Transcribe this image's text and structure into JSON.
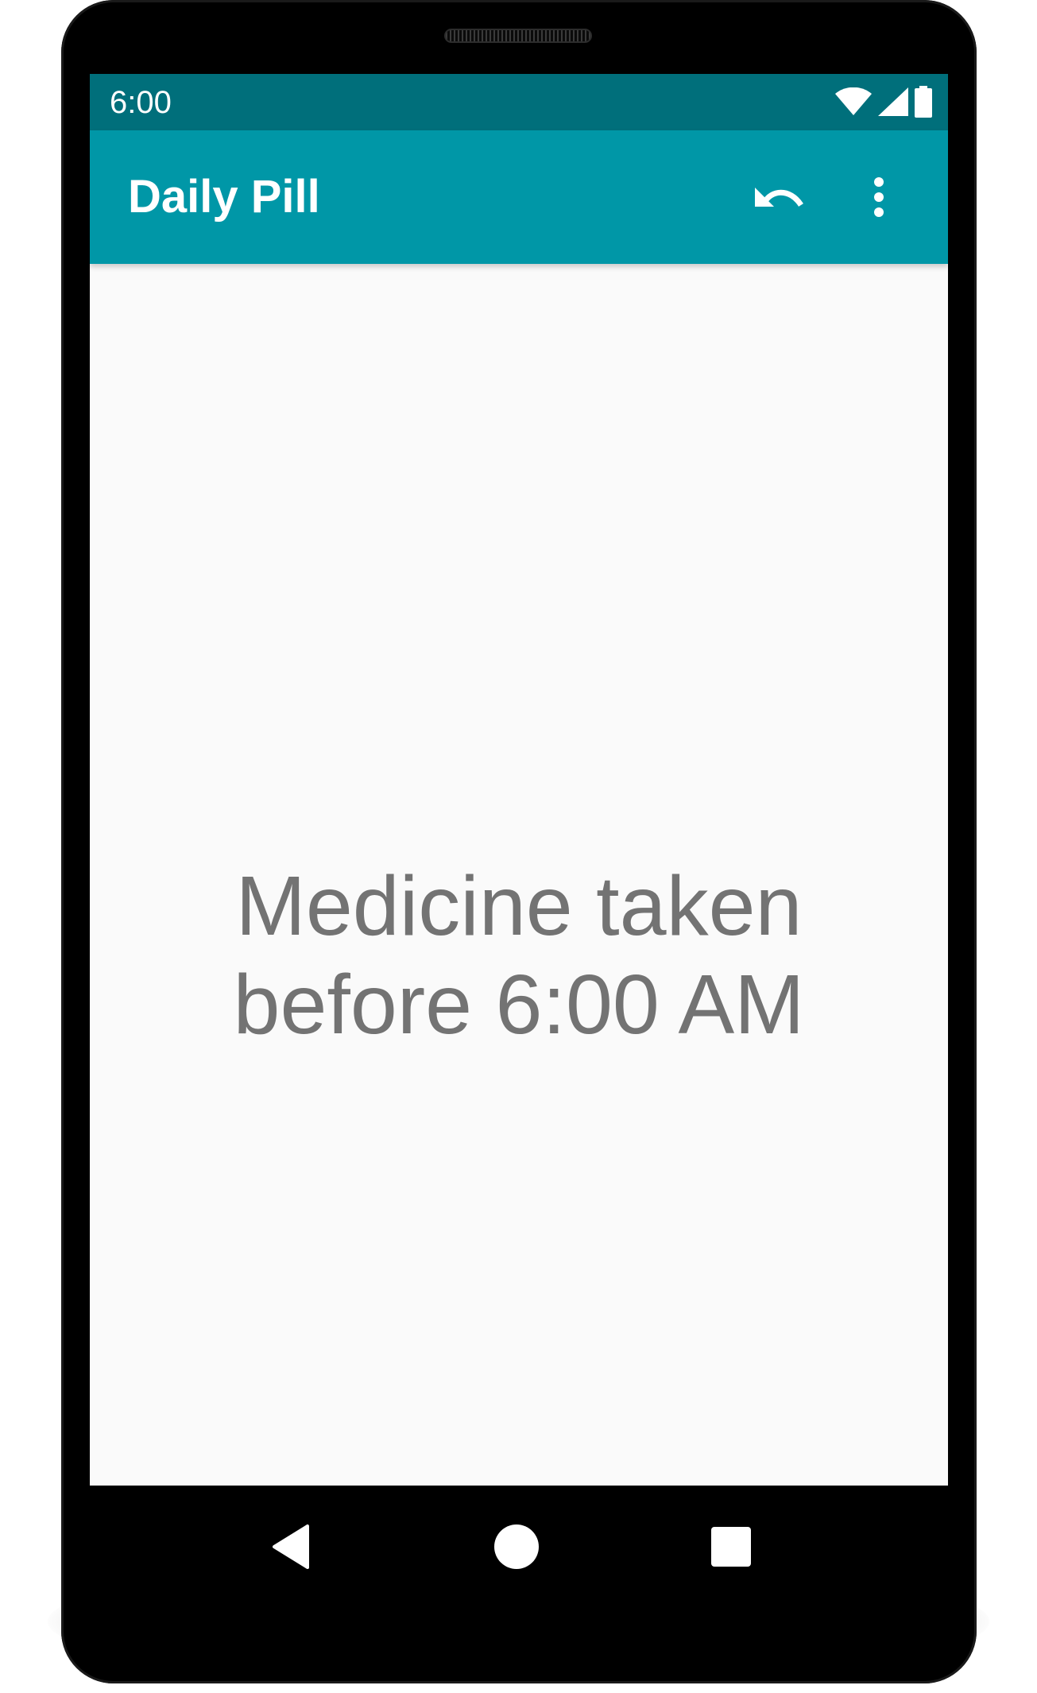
{
  "status_bar": {
    "time": "6:00",
    "icons": [
      "wifi-icon",
      "cell-signal-icon",
      "battery-icon"
    ]
  },
  "app_bar": {
    "title": "Daily Pill",
    "actions": [
      "undo-icon",
      "more-vert-icon"
    ]
  },
  "main": {
    "message": "Medicine taken\nbefore 6:00 AM"
  },
  "nav_bar": {
    "buttons": [
      "back-icon",
      "home-icon",
      "recents-icon"
    ]
  },
  "colors": {
    "status_bar": "#006f7b",
    "app_bar": "#0097a7",
    "background": "#fafafa",
    "message_text": "#737373",
    "phone_frame": "#000000"
  }
}
